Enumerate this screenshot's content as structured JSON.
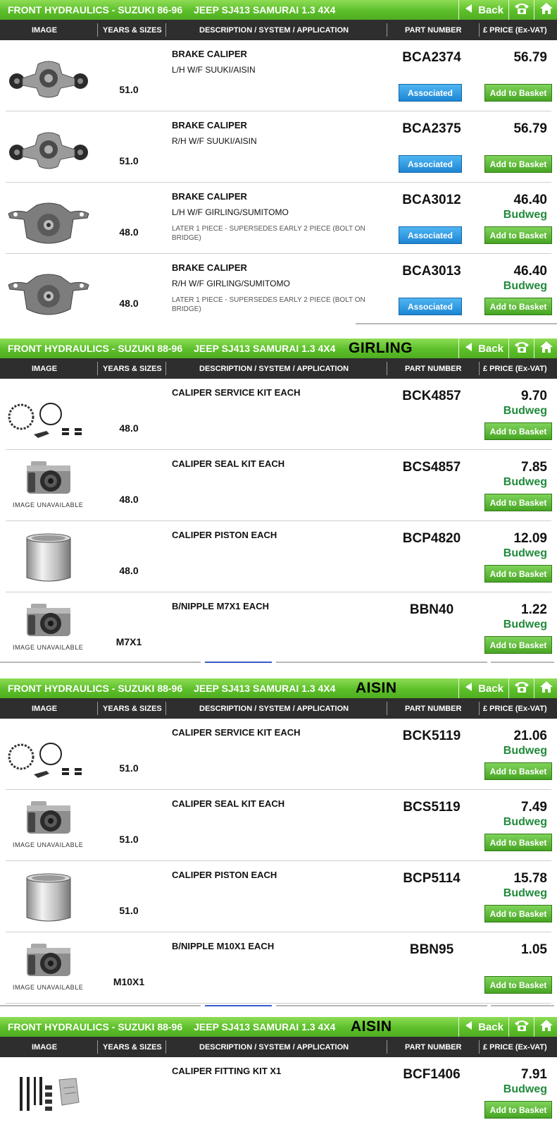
{
  "columns": {
    "image": "IMAGE",
    "years": "YEARS & SIZES",
    "description": "DESCRIPTION / SYSTEM  / APPLICATION",
    "part": "PART NUMBER",
    "price": "£ PRICE (Ex-VAT)"
  },
  "header": {
    "section": "FRONT HYDRAULICS - SUZUKI 88-96",
    "section_first": "FRONT HYDRAULICS - SUZUKI 86-96",
    "vehicle": "JEEP SJ413 SAMURAI 1.3 4X4",
    "back_label": "Back"
  },
  "buttons": {
    "associated": "Associated",
    "add": "Add to Basket"
  },
  "unavailable_text": "IMAGE UNAVAILABLE",
  "colors": {
    "header_green": "#5cbf2a",
    "budweg_green": "#1f8a3a",
    "associated_blue": "#1d86d4",
    "add_green": "#47a523",
    "column_bar": "#2e2e2e"
  },
  "panels": [
    {
      "brand": "",
      "rows": [
        {
          "image": "caliper-left-icon",
          "size": "51.0",
          "description": "BRAKE CALIPER",
          "application": "L/H W/F SUUKI/AISIN",
          "note": "",
          "part": "BCA2374",
          "price": "56.79",
          "price_brand": "",
          "associated": true
        },
        {
          "image": "caliper-right-icon",
          "size": "51.0",
          "description": "BRAKE CALIPER",
          "application": "R/H W/F SUUKI/AISIN",
          "note": "",
          "part": "BCA2375",
          "price": "56.79",
          "price_brand": "",
          "associated": true
        },
        {
          "image": "caliper-girling-left-icon",
          "size": "48.0",
          "description": "BRAKE CALIPER",
          "application": "L/H W/F GIRLING/SUMITOMO",
          "note": "LATER 1 PIECE - SUPERSEDES EARLY 2 PIECE (BOLT ON BRIDGE)",
          "part": "BCA3012",
          "price": "46.40",
          "price_brand": "Budweg",
          "associated": true
        },
        {
          "image": "caliper-girling-right-icon",
          "size": "48.0",
          "description": "BRAKE CALIPER",
          "application": "R/H W/F GIRLING/SUMITOMO",
          "note": "LATER 1 PIECE - SUPERSEDES EARLY 2 PIECE (BOLT ON BRIDGE)",
          "part": "BCA3013",
          "price": "46.40",
          "price_brand": "Budweg",
          "associated": true
        }
      ]
    },
    {
      "brand": "GIRLING",
      "rows": [
        {
          "image": "service-kit-icon",
          "size": "48.0",
          "description": "CALIPER SERVICE KIT EACH",
          "part": "BCK4857",
          "price": "9.70",
          "price_brand": "Budweg"
        },
        {
          "image": "camera-icon",
          "size": "48.0",
          "description": "CALIPER SEAL KIT EACH",
          "part": "BCS4857",
          "price": "7.85",
          "price_brand": "Budweg"
        },
        {
          "image": "piston-icon",
          "size": "48.0",
          "description": "CALIPER PISTON EACH",
          "part": "BCP4820",
          "price": "12.09",
          "price_brand": "Budweg"
        },
        {
          "image": "camera-icon",
          "size": "M7X1",
          "description": "B/NIPPLE M7X1 EACH",
          "part": "BBN40",
          "price": "1.22",
          "price_brand": "Budweg"
        }
      ]
    },
    {
      "brand": "AISIN",
      "rows": [
        {
          "image": "service-kit-icon",
          "size": "51.0",
          "description": "CALIPER SERVICE KIT EACH",
          "part": "BCK5119",
          "price": "21.06",
          "price_brand": "Budweg"
        },
        {
          "image": "camera-icon",
          "size": "51.0",
          "description": "CALIPER SEAL KIT EACH",
          "part": "BCS5119",
          "price": "7.49",
          "price_brand": "Budweg"
        },
        {
          "image": "piston-icon",
          "size": "51.0",
          "description": "CALIPER PISTON EACH",
          "part": "BCP5114",
          "price": "15.78",
          "price_brand": "Budweg"
        },
        {
          "image": "camera-icon",
          "size": "M10X1",
          "description": "B/NIPPLE M10X1 EACH",
          "part": "BBN95",
          "price": "1.05",
          "price_brand": ""
        }
      ]
    },
    {
      "brand": "AISIN",
      "rows": [
        {
          "image": "fitting-kit-icon",
          "size": "",
          "description": "CALIPER FITTING KIT X1",
          "part": "BCF1406",
          "price": "7.91",
          "price_brand": "Budweg"
        }
      ]
    }
  ]
}
